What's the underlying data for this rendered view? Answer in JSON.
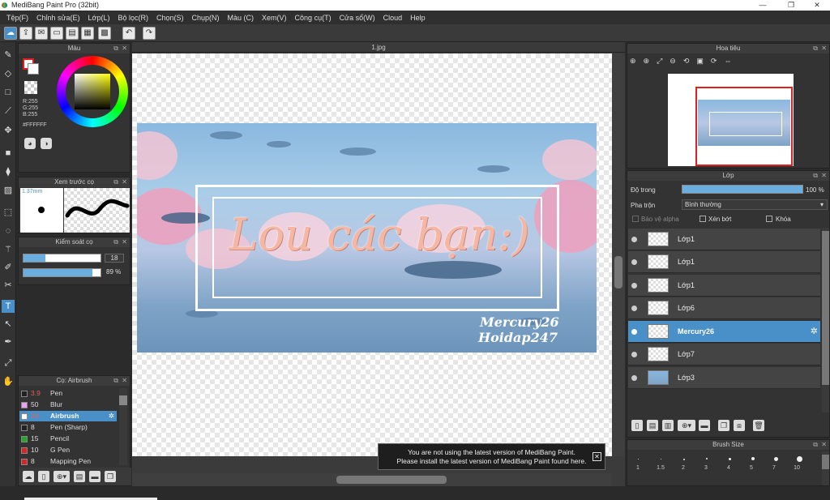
{
  "window": {
    "title": "MediBang Paint Pro (32bit)"
  },
  "menu": [
    "Tệp(F)",
    "Chỉnh sửa(E)",
    "Lớp(L)",
    "Bộ lọc(R)",
    "Chọn(S)",
    "Chụp(N)",
    "Màu (C)",
    "Xem(V)",
    "Công cụ(T)",
    "Cửa sổ(W)",
    "Cloud",
    "Help"
  ],
  "document": {
    "tab": "1.jpg"
  },
  "color_panel": {
    "title": "Màu",
    "r": "R:255",
    "g": "G:255",
    "b": "B:255",
    "hex": "#FFFFFF",
    "primary_color": "#ffffff",
    "secondary_color": "#e02020"
  },
  "brush_preview": {
    "title": "Xem trước cọ",
    "size": "1.37mm"
  },
  "brush_control": {
    "title": "Kiểm soát cọ",
    "size_value": "18",
    "opacity_value": "89 %",
    "size_fraction": 0.28,
    "opacity_fraction": 0.89
  },
  "brush_list": {
    "title": "Cọ: Airbrush",
    "items": [
      {
        "size": "3.9",
        "name": "Pen",
        "color": "#222222"
      },
      {
        "size": "50",
        "name": "Blur",
        "color": "#f0a0f0"
      },
      {
        "size": "18",
        "name": "Airbrush",
        "color": "#ffffff"
      },
      {
        "size": "8",
        "name": "Pen (Sharp)",
        "color": "#222222"
      },
      {
        "size": "15",
        "name": "Pencil",
        "color": "#22aa22"
      },
      {
        "size": "10",
        "name": "G Pen",
        "color": "#dd2222"
      },
      {
        "size": "8",
        "name": "Mapping Pen",
        "color": "#dd2222"
      }
    ],
    "selected_index": 2
  },
  "artwork": {
    "main_text": "Lou các bạn:)",
    "signature_1": "Mercury26",
    "signature_2": "Hoidap247"
  },
  "notice": {
    "line1": "You are not using the latest version of MediBang Paint.",
    "line2": "Please install the latest version of MediBang Paint found here."
  },
  "navigator": {
    "title": "Hoa tiêu"
  },
  "layer_panel": {
    "title": "Lớp",
    "opacity_label": "Độ trong",
    "opacity_value": "100 %",
    "blend_label": "Pha trộn",
    "blend_value": "Bình thường",
    "protect_alpha": "Bảo vệ alpha",
    "clipping": "Xén bớt",
    "lock": "Khóa",
    "layers": [
      "Lớp1",
      "Lớp1",
      "Lớp1",
      "Lớp6",
      "Mercury26",
      "Lớp7",
      "Lớp3"
    ],
    "selected_index": 4
  },
  "brush_size": {
    "title": "Brush Size",
    "labels": [
      "1",
      "1.5",
      "2",
      "3",
      "4",
      "5",
      "7",
      "10"
    ]
  },
  "icons": {
    "tools": [
      "brush-icon",
      "eraser-icon",
      "rect-icon",
      "line-icon",
      "move-icon",
      "fill-rect-icon",
      "bucket-icon",
      "gradient-icon",
      "select-icon",
      "lasso-icon",
      "magic-wand-icon",
      "select-pen-icon",
      "select-eraser-icon",
      "text-icon",
      "operation-icon",
      "eyedropper-icon",
      "hand-icon",
      "eyedropper2-icon"
    ]
  }
}
